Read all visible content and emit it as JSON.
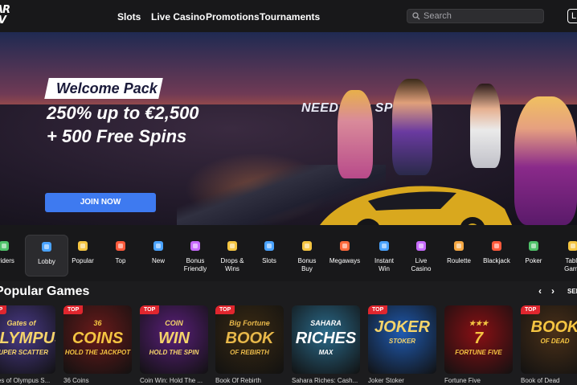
{
  "logo": {
    "line1": "AR",
    "line2": "IV"
  },
  "nav": {
    "slots": "Slots",
    "live_casino": "Live Casino",
    "promotions": "Promotions",
    "tournaments": "Tournaments"
  },
  "search": {
    "placeholder": "Search"
  },
  "header": {
    "login_label": "L"
  },
  "hero": {
    "tag": "Welcome Pack",
    "line1": "250% up to €2,500",
    "line2": "+ 500 Free Spins",
    "cta": "JOIN NOW",
    "brand_text": "NEED FOR SPIN",
    "slides": 5,
    "active_slide": 1
  },
  "categories": [
    {
      "label1": "oviders",
      "label2": "",
      "icon": "providers-icon",
      "color": "#4fc36a"
    },
    {
      "label1": "Lobby",
      "label2": "",
      "icon": "lobby-icon",
      "color": "#4aa3ff"
    },
    {
      "label1": "Popular",
      "label2": "",
      "icon": "crown-icon",
      "color": "#f5c542"
    },
    {
      "label1": "Top",
      "label2": "",
      "icon": "flame-icon",
      "color": "#ff5a3c"
    },
    {
      "label1": "New",
      "label2": "",
      "icon": "stopwatch-icon",
      "color": "#4aa3ff"
    },
    {
      "label1": "Bonus",
      "label2": "Friendly",
      "icon": "dollar-flask-icon",
      "color": "#c86bff"
    },
    {
      "label1": "Drops &",
      "label2": "Wins",
      "icon": "drops-wins-icon",
      "color": "#f5c542"
    },
    {
      "label1": "Slots",
      "label2": "",
      "icon": "slots-icon",
      "color": "#4aa3ff"
    },
    {
      "label1": "Bonus",
      "label2": "Buy",
      "icon": "bonus-buy-icon",
      "color": "#f5c542"
    },
    {
      "label1": "Megaways",
      "label2": "",
      "icon": "megaways-icon",
      "color": "#ff6a3c"
    },
    {
      "label1": "Instant",
      "label2": "Win",
      "icon": "instant-win-icon",
      "color": "#4aa3ff"
    },
    {
      "label1": "Live",
      "label2": "Casino",
      "icon": "live-casino-icon",
      "color": "#c86bff"
    },
    {
      "label1": "Roulette",
      "label2": "",
      "icon": "roulette-icon",
      "color": "#f5a742"
    },
    {
      "label1": "Blackjack",
      "label2": "",
      "icon": "blackjack-icon",
      "color": "#ff5a3c"
    },
    {
      "label1": "Poker",
      "label2": "",
      "icon": "poker-icon",
      "color": "#4fc36a"
    },
    {
      "label1": "Table",
      "label2": "Game",
      "icon": "table-games-icon",
      "color": "#f5c542"
    }
  ],
  "section": {
    "title": "Popular Games",
    "prev": "‹",
    "next": "›",
    "see_all": "SEE"
  },
  "games": [
    {
      "title": "Gates of Olympus S...",
      "tag": "TOP",
      "art1": "Gates of",
      "art2": "OLYMPUS",
      "art3": "SUPER SCATTER",
      "bg": "#4a3a8a",
      "fg": "#f5d46a"
    },
    {
      "title": "36 Coins",
      "tag": "TOP",
      "art1": "36",
      "art2": "COINS",
      "art3": "HOLD THE JACKPOT",
      "bg": "#6a1a1a",
      "fg": "#f5c542"
    },
    {
      "title": "Coin Win: Hold The ...",
      "tag": "TOP",
      "art1": "COIN",
      "art2": "WIN",
      "art3": "HOLD THE SPIN",
      "bg": "#5a1f7a",
      "fg": "#f5d46a"
    },
    {
      "title": "Book Of Rebirth",
      "tag": "TOP",
      "art1": "Big Fortune",
      "art2": "BOOK",
      "art3": "OF REBIRTH",
      "bg": "#3a2a12",
      "fg": "#e8b84a"
    },
    {
      "title": "Sahara Riches: Cash...",
      "tag": "",
      "art1": "SAHARA",
      "art2": "RICHES",
      "art3": "MAX",
      "bg": "#2a6a8a",
      "fg": "#ffffff"
    },
    {
      "title": "Joker Stoker",
      "tag": "TOP",
      "art1": "",
      "art2": "JOKER",
      "art3": "STOKER",
      "bg": "#1f5ab0",
      "fg": "#f5d46a"
    },
    {
      "title": "Fortune Five",
      "tag": "",
      "art1": "★★★",
      "art2": "7",
      "art3": "FORTUNE FIVE",
      "bg": "#8a0f14",
      "fg": "#f5c542"
    },
    {
      "title": "Book of Dead",
      "tag": "TOP",
      "art1": "",
      "art2": "BOOK",
      "art3": "OF DEAD",
      "bg": "#4a3018",
      "fg": "#f5c542"
    }
  ]
}
